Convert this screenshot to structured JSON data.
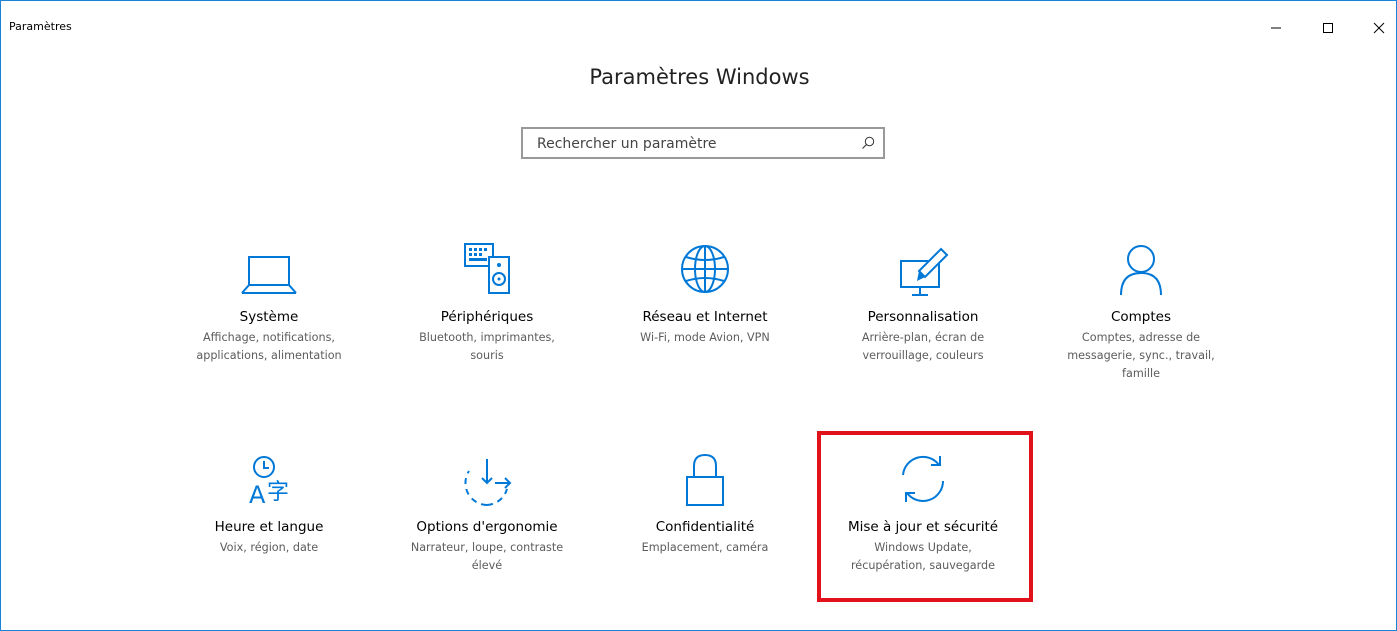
{
  "window": {
    "title": "Paramètres",
    "controls": {
      "minimize": "minimize-icon",
      "maximize": "maximize-icon",
      "close": "close-icon"
    }
  },
  "header": {
    "title": "Paramètres Windows"
  },
  "search": {
    "placeholder": "Rechercher un paramètre",
    "value": "",
    "icon": "search-icon"
  },
  "colors": {
    "accent": "#0078d7",
    "highlight": "#e2121a",
    "window_border": "#1883d7"
  },
  "tiles": [
    {
      "name": "Système",
      "desc": [
        "Affichage, notifications,",
        "applications, alimentation"
      ],
      "icon": "laptop-icon"
    },
    {
      "name": "Périphériques",
      "desc": [
        "Bluetooth, imprimantes,",
        "souris"
      ],
      "icon": "devices-icon"
    },
    {
      "name": "Réseau et Internet",
      "desc": [
        "Wi-Fi, mode Avion, VPN"
      ],
      "icon": "globe-icon"
    },
    {
      "name": "Personnalisation",
      "desc": [
        "Arrière-plan, écran de",
        "verrouillage, couleurs"
      ],
      "icon": "personalization-icon"
    },
    {
      "name": "Comptes",
      "desc": [
        "Comptes, adresse de",
        "messagerie, sync., travail,",
        "famille"
      ],
      "icon": "person-icon"
    },
    {
      "name": "Heure et langue",
      "desc": [
        "Voix, région, date"
      ],
      "icon": "time-language-icon"
    },
    {
      "name": "Options d'ergonomie",
      "desc": [
        "Narrateur, loupe, contraste",
        "élevé"
      ],
      "icon": "ease-of-access-icon"
    },
    {
      "name": "Confidentialité",
      "desc": [
        "Emplacement, caméra"
      ],
      "icon": "lock-icon"
    },
    {
      "name": "Mise à jour et sécurité",
      "desc": [
        "Windows Update,",
        "récupération, sauvegarde"
      ],
      "icon": "sync-icon",
      "highlighted": true
    }
  ]
}
